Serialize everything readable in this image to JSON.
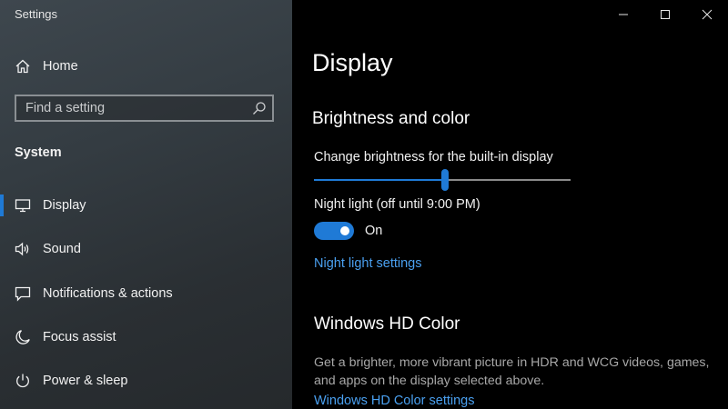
{
  "app": {
    "title": "Settings"
  },
  "sidebar": {
    "home_label": "Home",
    "search": {
      "placeholder": "Find a setting"
    },
    "section_title": "System",
    "items": [
      {
        "label": "Display",
        "icon": "monitor-icon",
        "selected": true
      },
      {
        "label": "Sound",
        "icon": "speaker-icon",
        "selected": false
      },
      {
        "label": "Notifications & actions",
        "icon": "notifications-icon",
        "selected": false
      },
      {
        "label": "Focus assist",
        "icon": "moon-icon",
        "selected": false
      },
      {
        "label": "Power & sleep",
        "icon": "power-icon",
        "selected": false
      }
    ]
  },
  "main": {
    "title": "Display",
    "brightness_section": {
      "title": "Brightness and color",
      "brightness_label": "Change brightness for the built-in display",
      "brightness_value": 0.51,
      "night_light_label": "Night light (off until 9:00 PM)",
      "toggle_state": "On",
      "night_light_link": "Night light settings"
    },
    "hd_section": {
      "title": "Windows HD Color",
      "description": "Get a brighter, more vibrant picture in HDR and WCG videos, games, and apps on the display selected above.",
      "link": "Windows HD Color settings"
    }
  },
  "colors": {
    "accent": "#1f7ad6",
    "link": "#4aa0f0",
    "background": "#000000",
    "sidebar": "#343c42"
  }
}
